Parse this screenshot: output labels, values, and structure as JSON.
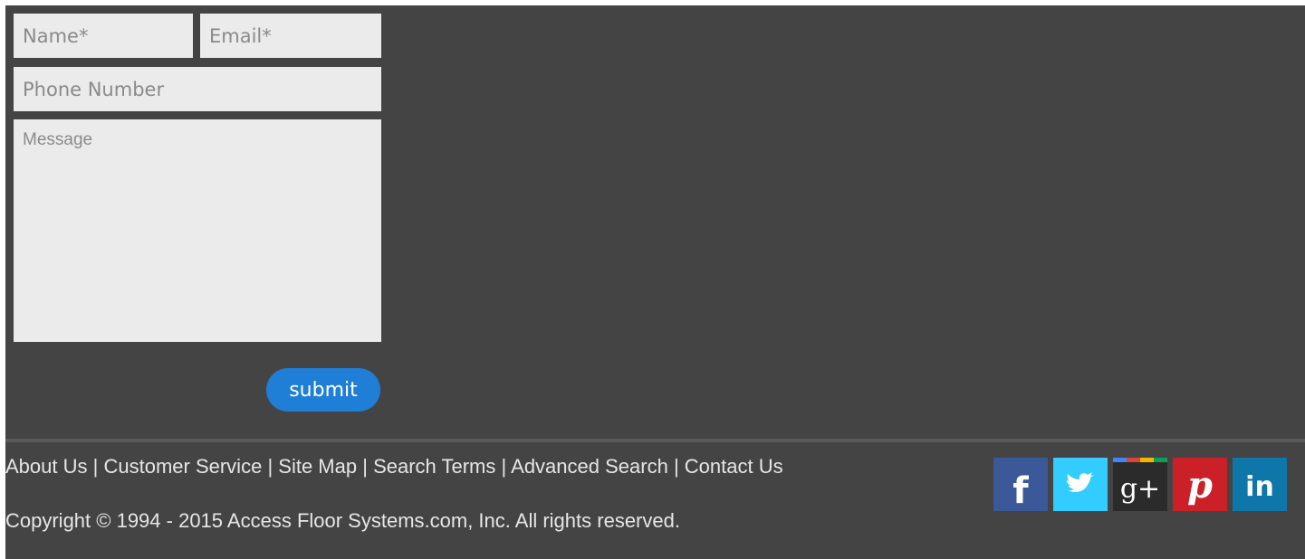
{
  "form": {
    "name_placeholder": "Name*",
    "email_placeholder": "Email*",
    "phone_placeholder": "Phone Number",
    "message_placeholder": "Message",
    "submit_label": "submit"
  },
  "footer": {
    "links": [
      "About Us",
      "Customer Service",
      "Site Map",
      "Search Terms",
      "Advanced Search",
      "Contact Us"
    ],
    "separator": "|",
    "copyright": "Copyright © 1994 - 2015 Access Floor Systems.com, Inc. All rights reserved."
  },
  "social": [
    {
      "icon": "facebook-icon",
      "glyph": "f",
      "color": "#3b5998"
    },
    {
      "icon": "twitter-icon",
      "color": "#33ccff"
    },
    {
      "icon": "google-plus-icon",
      "glyph": "g+",
      "color": "#2b2b2b"
    },
    {
      "icon": "pinterest-icon",
      "glyph": "p",
      "color": "#cb2027"
    },
    {
      "icon": "linkedin-icon",
      "glyph": "in",
      "color": "#0e76a8"
    }
  ],
  "colors": {
    "background": "#444444",
    "field": "#ebebeb",
    "submit": "#1f7fd6",
    "footer_text": "#e6e6e6"
  }
}
